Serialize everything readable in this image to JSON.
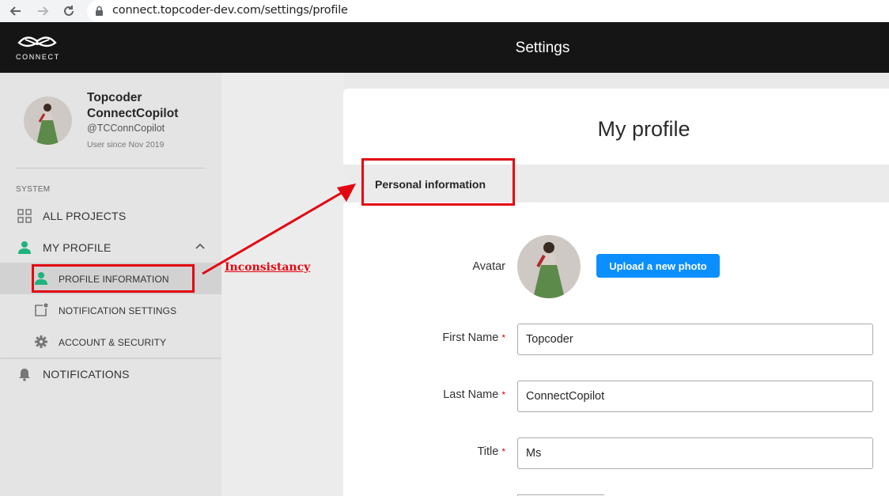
{
  "browser": {
    "url": "connect.topcoder-dev.com/settings/profile"
  },
  "header": {
    "logo_text": "CONNECT",
    "title": "Settings"
  },
  "user": {
    "name": "Topcoder ConnectCopilot",
    "handle": "@TCConnCopilot",
    "since": "User since Nov 2019"
  },
  "sidebar": {
    "section_label": "SYSTEM",
    "items": [
      {
        "label": "ALL PROJECTS",
        "icon": "grid-icon"
      },
      {
        "label": "MY PROFILE",
        "icon": "person-icon",
        "expanded": true
      },
      {
        "label": "NOTIFICATIONS",
        "icon": "bell-icon"
      }
    ],
    "submenu": [
      {
        "label": "PROFILE INFORMATION",
        "icon": "person-icon",
        "active": true
      },
      {
        "label": "NOTIFICATION SETTINGS",
        "icon": "notification-square-icon"
      },
      {
        "label": "ACCOUNT & SECURITY",
        "icon": "gear-icon"
      }
    ]
  },
  "annotation": {
    "text": "Inconsistancy",
    "color": "#e3050f"
  },
  "main": {
    "title": "My profile",
    "section_title": "Personal information",
    "avatar_label": "Avatar",
    "upload_label": "Upload a new photo",
    "fields": [
      {
        "label": "First Name",
        "value": "Topcoder",
        "required": true
      },
      {
        "label": "Last Name",
        "value": "ConnectCopilot",
        "required": true
      },
      {
        "label": "Title",
        "value": "Ms",
        "required": true
      }
    ],
    "required_mark": "*"
  },
  "colors": {
    "accent": "#0b8fff",
    "active_icon": "#1db37e",
    "header_bg": "#151516"
  }
}
